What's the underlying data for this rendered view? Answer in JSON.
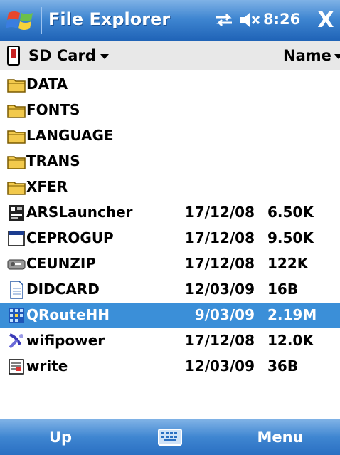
{
  "titlebar": {
    "title": "File Explorer",
    "time": "8:26",
    "close_label": "X",
    "start_icon": "windows-flag-icon",
    "status_icons": [
      "sync-arrows-icon",
      "volume-muted-icon"
    ]
  },
  "location": {
    "folder": "SD Card",
    "sort_by": "Name"
  },
  "files": [
    {
      "name": "DATA",
      "date": "",
      "size": "",
      "icon": "folder-icon"
    },
    {
      "name": "FONTS",
      "date": "",
      "size": "",
      "icon": "folder-icon"
    },
    {
      "name": "LANGUAGE",
      "date": "",
      "size": "",
      "icon": "folder-icon"
    },
    {
      "name": "TRANS",
      "date": "",
      "size": "",
      "icon": "folder-icon"
    },
    {
      "name": "XFER",
      "date": "",
      "size": "",
      "icon": "folder-icon"
    },
    {
      "name": "ARSLauncher",
      "date": "17/12/08",
      "size": "6.50K",
      "icon": "app-icon"
    },
    {
      "name": "CEPROGUP",
      "date": "17/12/08",
      "size": "9.50K",
      "icon": "window-icon"
    },
    {
      "name": "CEUNZIP",
      "date": "17/12/08",
      "size": "122K",
      "icon": "tool-icon"
    },
    {
      "name": "DIDCARD",
      "date": "12/03/09",
      "size": "16B",
      "icon": "document-icon"
    },
    {
      "name": "QRouteHH",
      "date": "9/03/09",
      "size": "2.19M",
      "icon": "grid-app-icon",
      "selected": true
    },
    {
      "name": "wifipower",
      "date": "17/12/08",
      "size": "12.0K",
      "icon": "satellite-icon"
    },
    {
      "name": "write",
      "date": "12/03/09",
      "size": "36B",
      "icon": "wordpad-icon"
    }
  ],
  "softkeys": {
    "left": "Up",
    "right": "Menu",
    "keyboard_icon": "keyboard-icon"
  },
  "colors": {
    "titlebar": "#3f86d1",
    "selection": "#3b8fd8",
    "folder": "#f2c94c"
  }
}
